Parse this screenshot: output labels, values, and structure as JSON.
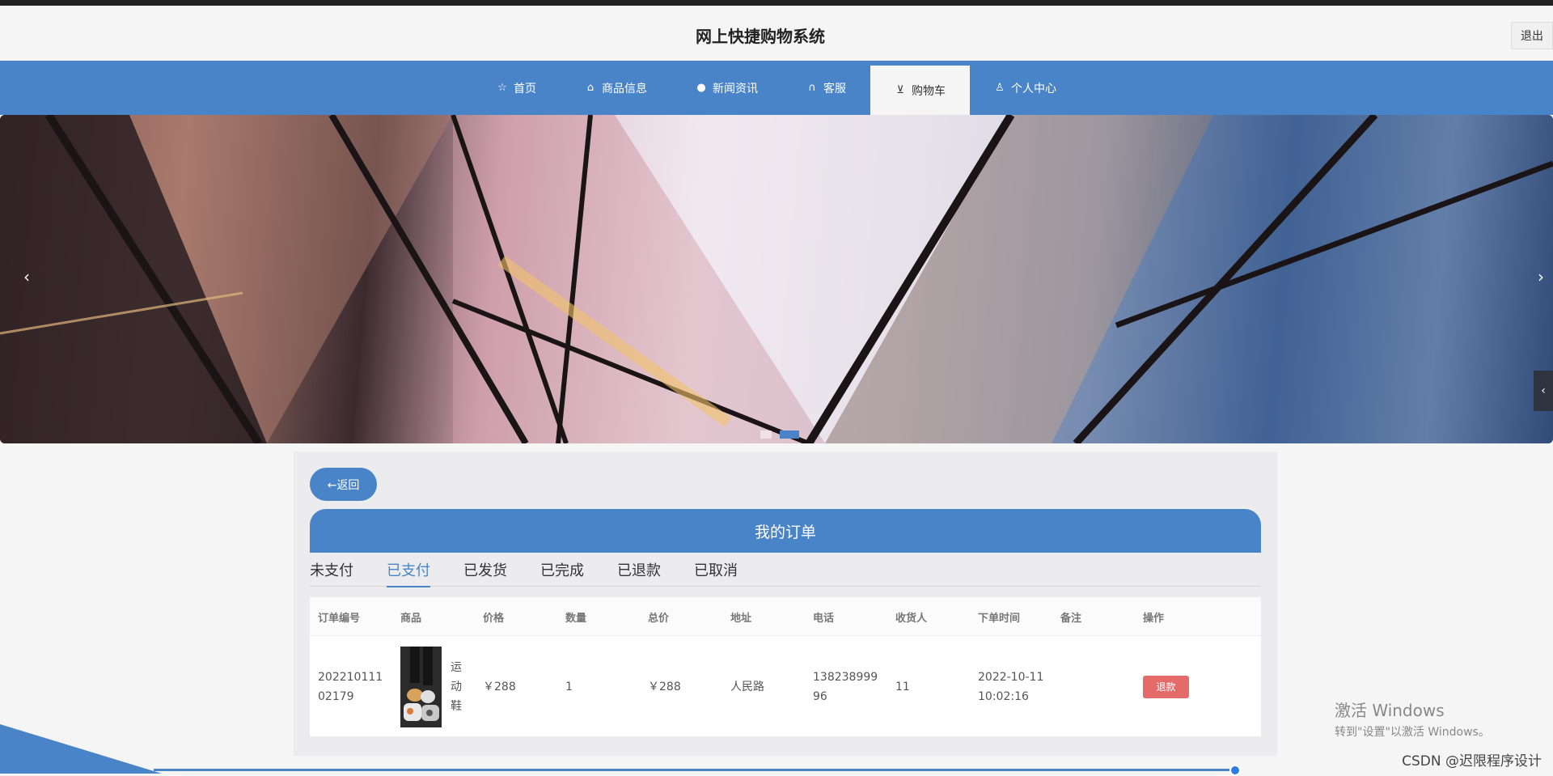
{
  "header": {
    "site_title": "网上快捷购物系统",
    "logout_label": "退出"
  },
  "nav": {
    "items": [
      {
        "label": "首页",
        "icon": "star-icon"
      },
      {
        "label": "商品信息",
        "icon": "bag-icon"
      },
      {
        "label": "新闻资讯",
        "icon": "info-icon"
      },
      {
        "label": "客服",
        "icon": "headset-icon"
      },
      {
        "label": "购物车",
        "icon": "cart-icon",
        "active": true
      },
      {
        "label": "个人中心",
        "icon": "user-icon"
      }
    ]
  },
  "carousel": {
    "prev": "‹",
    "next": "›",
    "slides": 2,
    "active_slide": 2
  },
  "side_tab": {
    "icon": "‹"
  },
  "orders": {
    "back_label": "←返回",
    "title": "我的订单",
    "tabs": [
      "未支付",
      "已支付",
      "已发货",
      "已完成",
      "已退款",
      "已取消"
    ],
    "active_tab": "已支付",
    "columns": [
      "订单编号",
      "商品",
      "价格",
      "数量",
      "总价",
      "地址",
      "电话",
      "收货人",
      "下单时间",
      "备注",
      "操作"
    ],
    "rows": [
      {
        "order_no": "20221011102179",
        "order_no_display": [
          "202210111",
          "02179"
        ],
        "product": "运动鞋",
        "price": "￥288",
        "qty": "1",
        "total": "￥288",
        "address": "人民路",
        "phone_display": [
          "138238999",
          "96"
        ],
        "receiver": "11",
        "time_display": [
          "2022-10-11",
          "10:02:16"
        ],
        "note": "",
        "action": "退款"
      }
    ]
  },
  "overlay": {
    "activate_title": "激活 Windows",
    "activate_sub": "转到\"设置\"以激活 Windows。",
    "csdn": "CSDN @迟限程序设计"
  },
  "colors": {
    "primary": "#4a84c8",
    "refund": "#e56b6b"
  }
}
